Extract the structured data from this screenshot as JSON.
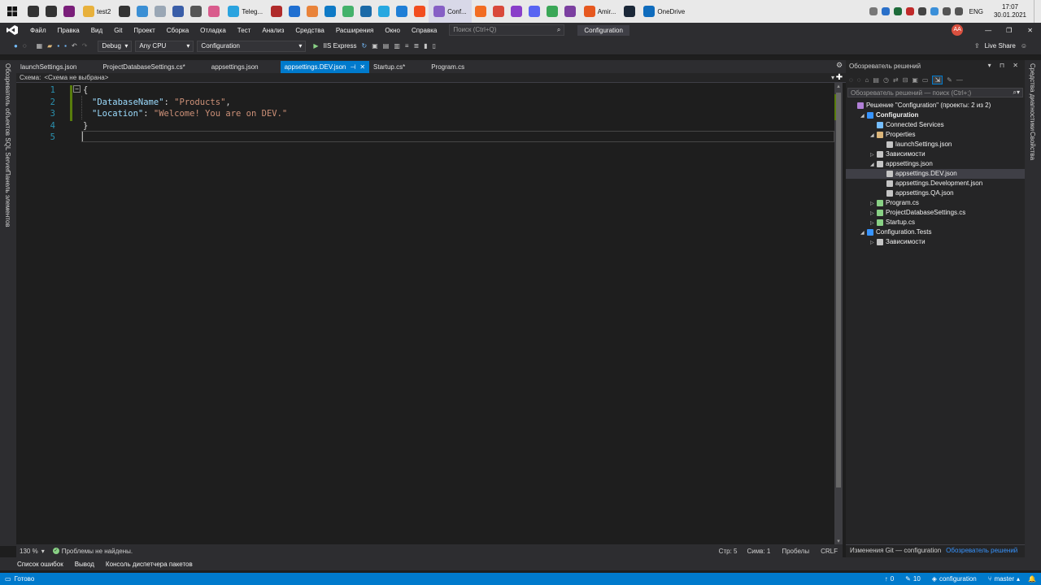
{
  "taskbar": {
    "items": [
      {
        "label": "",
        "icon": "search-icon",
        "color": "#333333"
      },
      {
        "label": "",
        "icon": "task-view-icon",
        "color": "#333333"
      },
      {
        "label": "",
        "icon": "app-icon",
        "color": "#7a1f7a"
      },
      {
        "label": "test2",
        "icon": "folder-icon",
        "color": "#e8b13c"
      },
      {
        "label": "",
        "icon": "gear-icon",
        "color": "#333333"
      },
      {
        "label": "",
        "icon": "app-icon",
        "color": "#3b8fd4"
      },
      {
        "label": "",
        "icon": "app-icon",
        "color": "#9aa7b5"
      },
      {
        "label": "",
        "icon": "app-icon",
        "color": "#3a5ea8"
      },
      {
        "label": "",
        "icon": "calculator-icon",
        "color": "#555555"
      },
      {
        "label": "",
        "icon": "app-icon",
        "color": "#d95b8c"
      },
      {
        "label": "Teleg...",
        "icon": "telegram-icon",
        "color": "#2aa3df"
      },
      {
        "label": "",
        "icon": "app-icon",
        "color": "#b02a2a"
      },
      {
        "label": "",
        "icon": "mail-icon",
        "color": "#1f6fd1"
      },
      {
        "label": "",
        "icon": "app-icon",
        "color": "#e9833a"
      },
      {
        "label": "",
        "icon": "edge-icon",
        "color": "#0f7ac6"
      },
      {
        "label": "",
        "icon": "app-icon",
        "color": "#44b26b"
      },
      {
        "label": "",
        "icon": "app-icon",
        "color": "#1b6aa8"
      },
      {
        "label": "",
        "icon": "app-icon",
        "color": "#27a8e0"
      },
      {
        "label": "",
        "icon": "vscode-icon",
        "color": "#1f7fd6"
      },
      {
        "label": "",
        "icon": "figma-icon",
        "color": "#f24e1e"
      },
      {
        "label": "Conf...",
        "icon": "visual-studio-icon",
        "color": "#865fc5"
      },
      {
        "label": "",
        "icon": "app-icon",
        "color": "#f26d21"
      },
      {
        "label": "",
        "icon": "app-icon",
        "color": "#d94a3a"
      },
      {
        "label": "",
        "icon": "app-icon",
        "color": "#8a3fc9"
      },
      {
        "label": "",
        "icon": "discord-icon",
        "color": "#5865f2"
      },
      {
        "label": "",
        "icon": "chrome-icon",
        "color": "#3aa757"
      },
      {
        "label": "",
        "icon": "app-icon",
        "color": "#7b3fa0"
      },
      {
        "label": "Amir...",
        "icon": "firefox-icon",
        "color": "#e6581f"
      },
      {
        "label": "",
        "icon": "steam-icon",
        "color": "#1b2838"
      },
      {
        "label": "OneDrive",
        "icon": "onedrive-icon",
        "color": "#0f6cbd"
      }
    ],
    "tray": {
      "language": "ENG",
      "time": "17:07",
      "date": "30.01.2021"
    }
  },
  "menu": [
    "Файл",
    "Правка",
    "Вид",
    "Git",
    "Проект",
    "Сборка",
    "Отладка",
    "Тест",
    "Анализ",
    "Средства",
    "Расширения",
    "Окно",
    "Справка"
  ],
  "search": {
    "placeholder": "Поиск (Ctrl+Q)"
  },
  "window_title": "Configuration",
  "user_initials": "AA",
  "toolbar": {
    "config": "Debug",
    "platform": "Any CPU",
    "startup_project": "Configuration",
    "run_label": "IIS Express",
    "live_share": "Live Share"
  },
  "left_panels": [
    "Обозреватель объектов SQL Server",
    "Панель элементов"
  ],
  "right_panels": [
    "Средства диагностики",
    "Свойства"
  ],
  "tabs": [
    {
      "label": "launchSettings.json",
      "active": false
    },
    {
      "label": "ProjectDatabaseSettings.cs*",
      "active": false
    },
    {
      "label": "appsettings.json",
      "active": false
    },
    {
      "label": "appsettings.DEV.json",
      "active": true
    },
    {
      "label": "Startup.cs*",
      "active": false
    },
    {
      "label": "Program.cs",
      "active": false
    }
  ],
  "schema": {
    "label": "Схема:",
    "value": "<Схема не выбрана>"
  },
  "code_lines": [
    {
      "n": "1",
      "text": "{"
    },
    {
      "n": "2",
      "key": "\"DatabaseName\"",
      "sep": ": ",
      "val": "\"Products\"",
      "tail": ","
    },
    {
      "n": "3",
      "key": "\"Location\"",
      "sep": ": ",
      "val": "\"Welcome! You are on DEV.\"",
      "tail": ""
    },
    {
      "n": "4",
      "text": "}"
    },
    {
      "n": "5",
      "text": ""
    }
  ],
  "solution": {
    "title": "Обозреватель решений",
    "search_placeholder": "Обозреватель решений — поиск (Ctrl+;)",
    "items": [
      {
        "label": "Решение \"Configuration\" (проекты: 2 из 2)",
        "indent": 0,
        "icon": "solution-icon",
        "bold": false
      },
      {
        "label": "Configuration",
        "indent": 1,
        "icon": "project-icon",
        "bold": true
      },
      {
        "label": "Connected Services",
        "indent": 2,
        "icon": "connected-services-icon",
        "bold": false
      },
      {
        "label": "Properties",
        "indent": 2,
        "icon": "folder-icon",
        "bold": false
      },
      {
        "label": "launchSettings.json",
        "indent": 3,
        "icon": "json-file-icon",
        "bold": false
      },
      {
        "label": "Зависимости",
        "indent": 2,
        "icon": "dependencies-icon",
        "bold": false
      },
      {
        "label": "appsettings.json",
        "indent": 2,
        "icon": "json-file-icon",
        "bold": false
      },
      {
        "label": "appsettings.DEV.json",
        "indent": 3,
        "icon": "json-file-icon",
        "bold": false,
        "selected": true
      },
      {
        "label": "appsettings.Development.json",
        "indent": 3,
        "icon": "json-file-icon",
        "bold": false
      },
      {
        "label": "appsettings.QA.json",
        "indent": 3,
        "icon": "json-file-icon",
        "bold": false
      },
      {
        "label": "Program.cs",
        "indent": 2,
        "icon": "csharp-file-icon",
        "bold": false
      },
      {
        "label": "ProjectDatabaseSettings.cs",
        "indent": 2,
        "icon": "csharp-file-icon",
        "bold": false
      },
      {
        "label": "Startup.cs",
        "indent": 2,
        "icon": "csharp-file-icon",
        "bold": false
      },
      {
        "label": "Configuration.Tests",
        "indent": 1,
        "icon": "project-icon",
        "bold": false
      },
      {
        "label": "Зависимости",
        "indent": 2,
        "icon": "dependencies-icon",
        "bold": false
      }
    ],
    "bottom_tabs": [
      "Изменения Git — configuration",
      "Обозреватель решений"
    ]
  },
  "editor_status": {
    "zoom": "130 %",
    "problems": "Проблемы не найдены.",
    "line": "Стр: 5",
    "col": "Симв: 1",
    "spaces": "Пробелы",
    "eol": "CRLF"
  },
  "bottom_tabs": [
    "Список ошибок",
    "Вывод",
    "Консоль диспетчера пакетов"
  ],
  "statusbar": {
    "ready": "Готово",
    "up": "0",
    "pencil": "10",
    "repo": "configuration",
    "branch": "master"
  },
  "colors": {
    "accent": "#007acc",
    "json_key": "#9cdcfe",
    "json_string": "#ce9178",
    "line_number": "#2b91af"
  }
}
